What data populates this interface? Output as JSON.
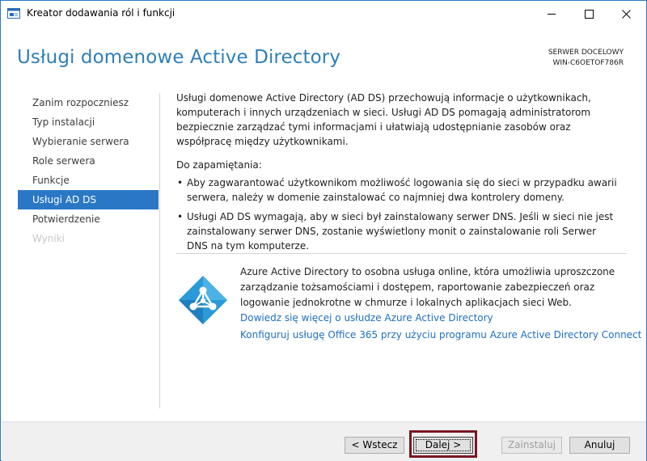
{
  "window": {
    "title": "Kreator dodawania ról i funkcji"
  },
  "page": {
    "title": "Usługi domenowe Active Directory",
    "target_label": "SERWER DOCELOWY",
    "target_server": "WIN-C6OETOF786R"
  },
  "nav": {
    "items": [
      {
        "label": "Zanim rozpoczniesz",
        "state": "normal"
      },
      {
        "label": "Typ instalacji",
        "state": "normal"
      },
      {
        "label": "Wybieranie serwera",
        "state": "normal"
      },
      {
        "label": "Role serwera",
        "state": "normal"
      },
      {
        "label": "Funkcje",
        "state": "normal"
      },
      {
        "label": "Usługi AD DS",
        "state": "active"
      },
      {
        "label": "Potwierdzenie",
        "state": "normal"
      },
      {
        "label": "Wyniki",
        "state": "disabled"
      }
    ]
  },
  "content": {
    "intro": "Usługi domenowe Active Directory (AD DS) przechowują informacje o użytkownikach, komputerach i innych urządzeniach w sieci. Usługi AD DS pomagają administratorom bezpiecznie zarządzać tymi informacjami i ułatwiają udostępnianie zasobów oraz współpracę między użytkownikami.",
    "notes_title": "Do zapamiętania:",
    "notes": [
      "Aby zagwarantować użytkownikom możliwość logowania się do sieci w przypadku awarii serwera, należy w domenie zainstalować co najmniej dwa kontrolery domeny.",
      "Usługi AD DS wymagają, aby w sieci był zainstalowany serwer DNS. Jeśli w sieci nie jest zainstalowany serwer DNS, zostanie wyświetlony monit o zainstalowanie roli Serwer DNS na tym komputerze."
    ]
  },
  "azure": {
    "description": "Azure Active Directory to osobna usługa online, która umożliwia uproszczone zarządzanie tożsamościami i dostępem, raportowanie zabezpieczeń oraz logowanie jednokrotne w chmurze i lokalnych aplikacjach sieci Web.",
    "link_learn_more": "Dowiedz się więcej o usłudze Azure Active Directory",
    "link_configure": "Konfiguruj usługę Office 365 przy użyciu programu Azure Active Directory Connect",
    "logo_icon": "azure-ad-icon"
  },
  "buttons": {
    "back": "< Wstecz",
    "next": "Dalej >",
    "install": "Zainstaluj",
    "cancel": "Anuluj"
  },
  "colors": {
    "accent": "#2a78c5",
    "heading": "#2f7fb8",
    "link": "#1f6fc1",
    "focus_outline": "#7b1623"
  }
}
